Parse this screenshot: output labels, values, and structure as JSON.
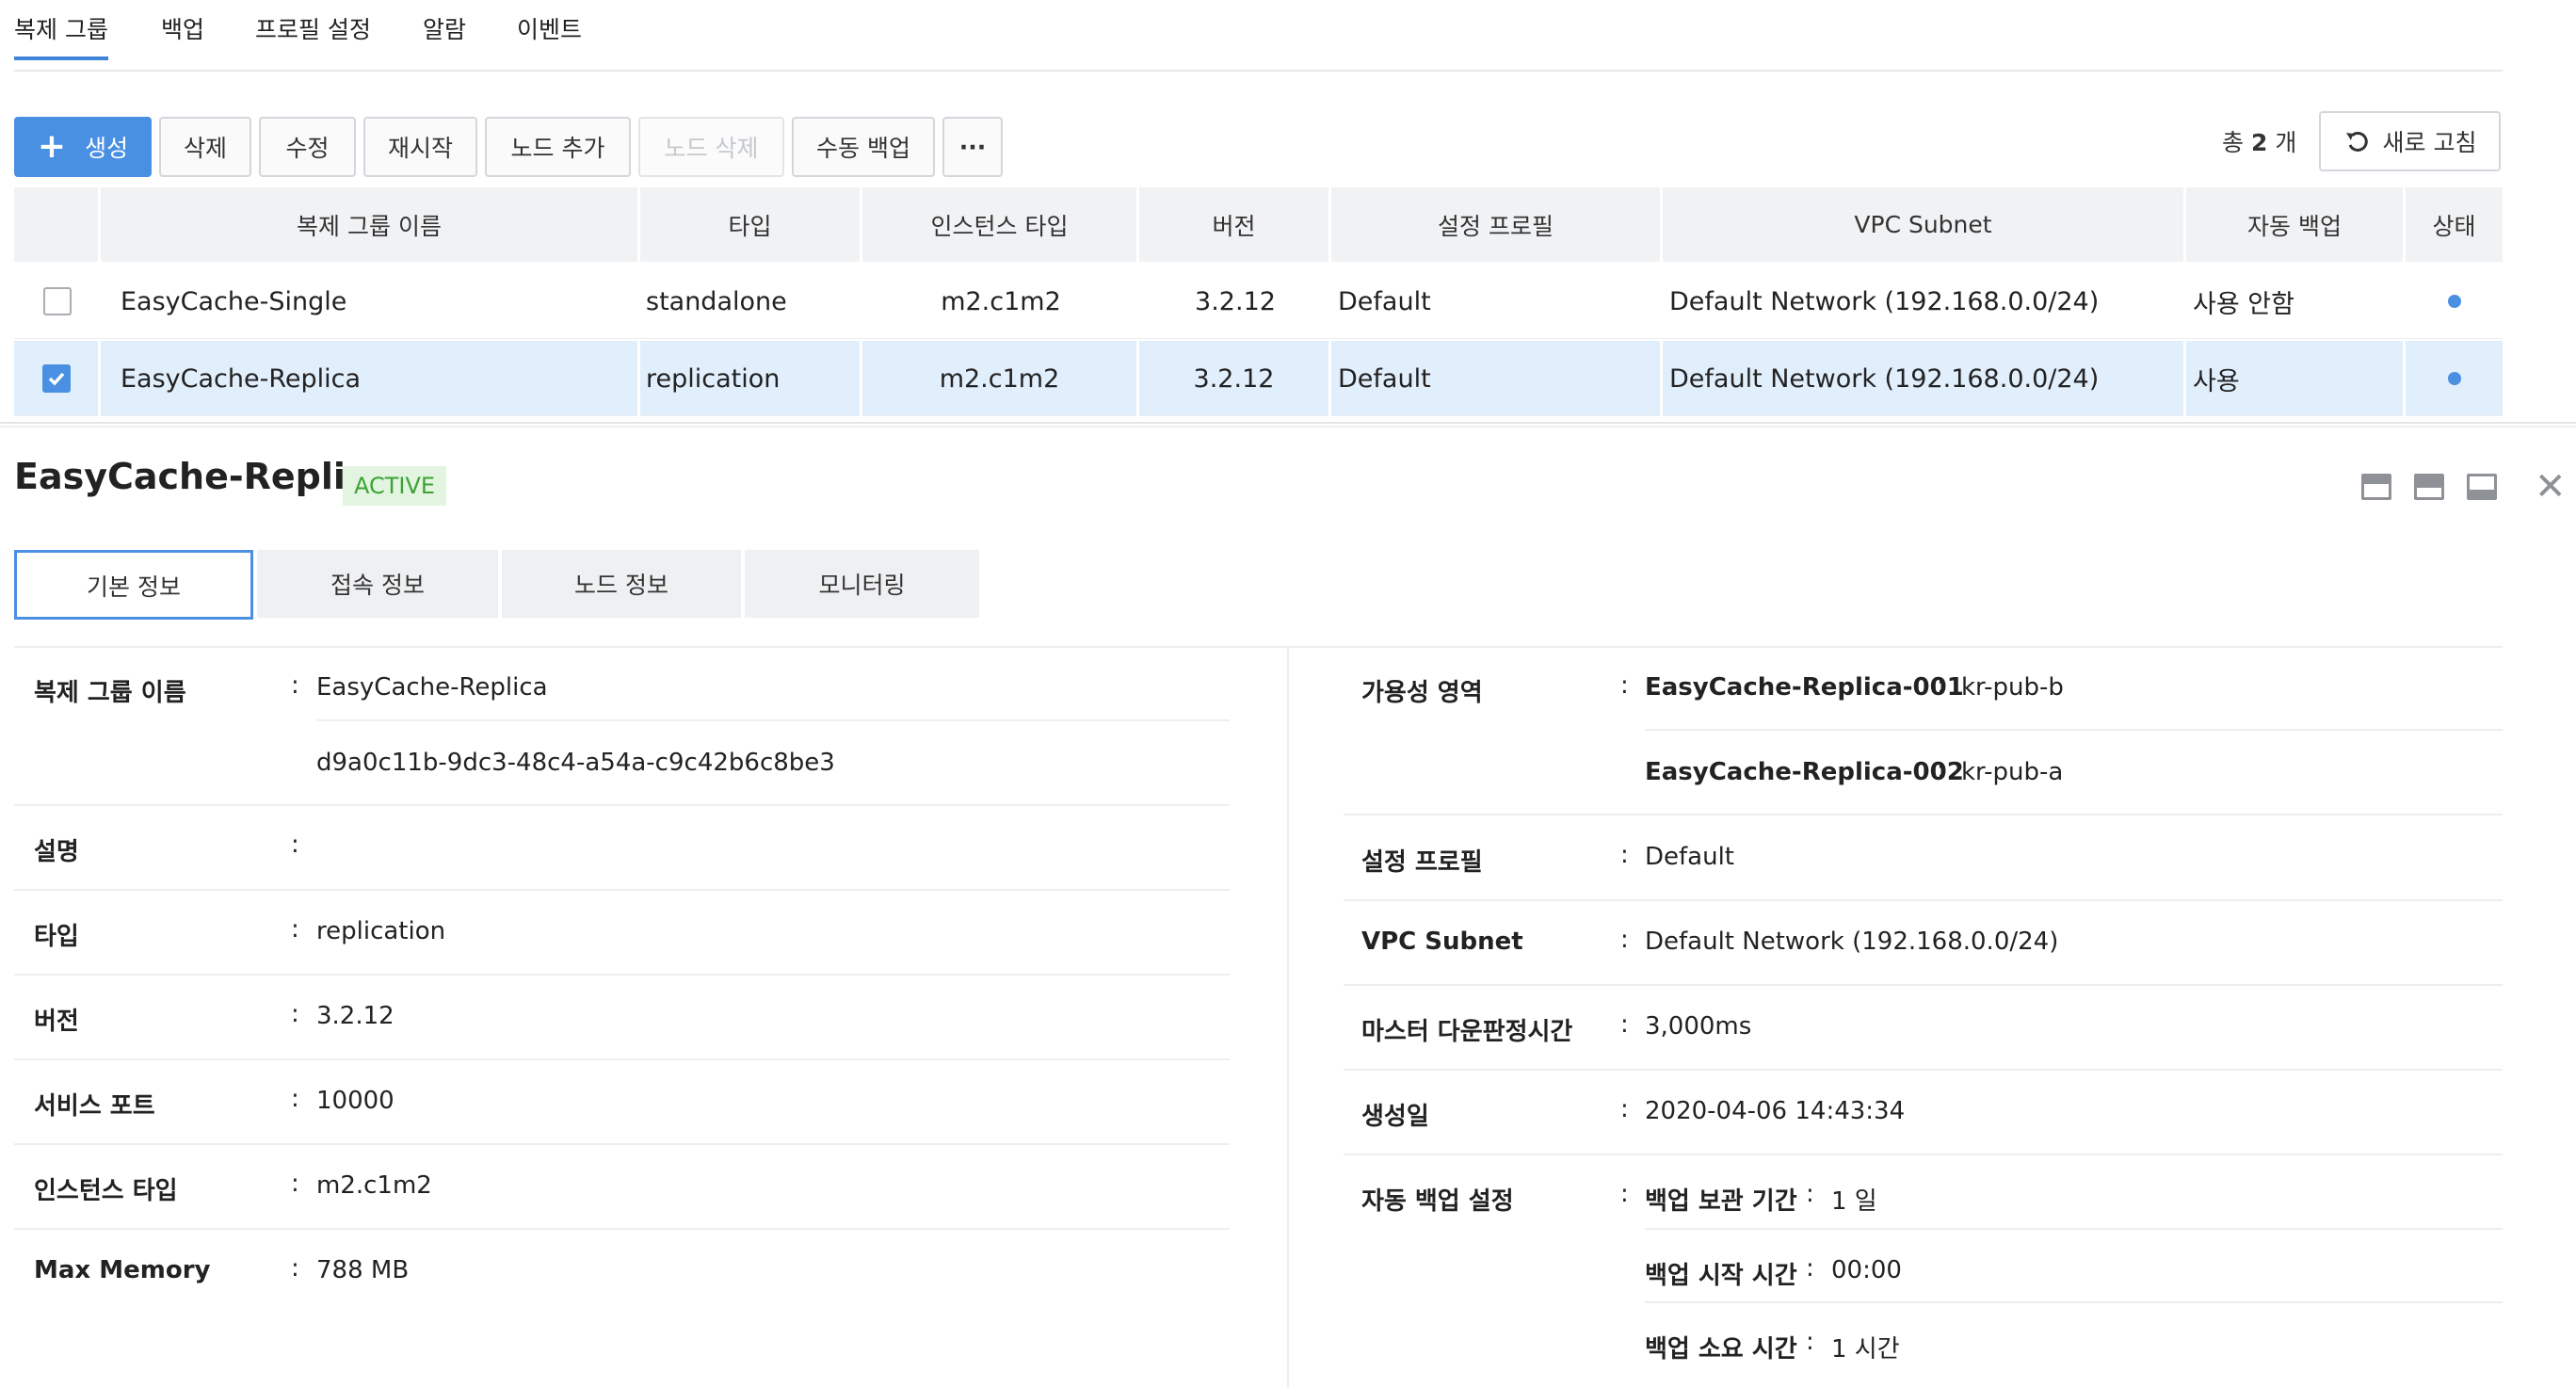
{
  "top_tabs": [
    "복제 그룹",
    "백업",
    "프로필 설정",
    "알람",
    "이벤트"
  ],
  "toolbar": {
    "create": "생성",
    "delete": "삭제",
    "edit": "수정",
    "restart": "재시작",
    "add_node": "노드 추가",
    "delete_node": "노드 삭제",
    "manual_backup": "수동 백업",
    "more": "···",
    "total_prefix": "총",
    "total_count": "2",
    "total_suffix": "개",
    "refresh": "새로 고침"
  },
  "table": {
    "headers": [
      "복제 그룹 이름",
      "타입",
      "인스턴스 타입",
      "버전",
      "설정 프로필",
      "VPC Subnet",
      "자동 백업",
      "상태"
    ],
    "rows": [
      {
        "checked": false,
        "name": "EasyCache-Single",
        "type": "standalone",
        "instance_type": "m2.c1m2",
        "version": "3.2.12",
        "profile": "Default",
        "subnet": "Default Network (192.168.0.0/24)",
        "auto_backup": "사용 안함",
        "status_color": "#4a90e2"
      },
      {
        "checked": true,
        "name": "EasyCache-Replica",
        "type": "replication",
        "instance_type": "m2.c1m2",
        "version": "3.2.12",
        "profile": "Default",
        "subnet": "Default Network (192.168.0.0/24)",
        "auto_backup": "사용",
        "status_color": "#4a90e2"
      }
    ]
  },
  "detail": {
    "title": "EasyCache-Replica",
    "status_badge": "ACTIVE",
    "tabs": [
      "기본 정보",
      "접속 정보",
      "노드 정보",
      "모니터링"
    ],
    "left": {
      "name_label": "복제 그룹 이름",
      "name_value": "EasyCache-Replica",
      "id_value": "d9a0c11b-9dc3-48c4-a54a-c9c42b6c8be3",
      "desc_label": "설명",
      "desc_value": "",
      "type_label": "타입",
      "type_value": "replication",
      "version_label": "버전",
      "version_value": "3.2.12",
      "port_label": "서비스 포트",
      "port_value": "10000",
      "instance_label": "인스턴스 타입",
      "instance_value": "m2.c1m2",
      "memory_label": "Max Memory",
      "memory_value": "788 MB"
    },
    "right": {
      "az_label": "가용성 영역",
      "az": [
        {
          "node": "EasyCache-Replica-001",
          "zone": "kr-pub-b"
        },
        {
          "node": "EasyCache-Replica-002",
          "zone": "kr-pub-a"
        }
      ],
      "profile_label": "설정 프로필",
      "profile_value": "Default",
      "subnet_label": "VPC Subnet",
      "subnet_value": "Default Network (192.168.0.0/24)",
      "failover_label": "마스터 다운판정시간",
      "failover_value": "3,000ms",
      "created_label": "생성일",
      "created_value": "2020-04-06 14:43:34",
      "backup_label": "자동 백업 설정",
      "backup": [
        {
          "label": "백업 보관 기간",
          "value": "1 일"
        },
        {
          "label": "백업 시작 시간",
          "value": "00:00"
        },
        {
          "label": "백업 소요 시간",
          "value": "1 시간"
        }
      ]
    }
  },
  "colon": ":"
}
